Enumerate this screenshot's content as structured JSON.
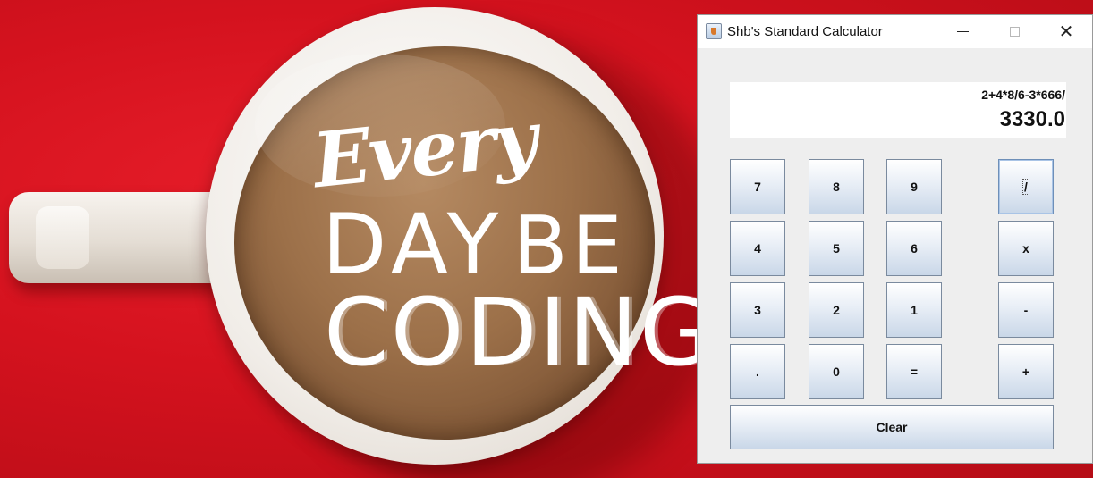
{
  "window": {
    "title": "Shb's Standard Calculator",
    "controls": {
      "minimize": "—",
      "maximize": "☐",
      "close": "✕"
    }
  },
  "display": {
    "expression": "2+4*8/6-3*666/",
    "result": "3330.0"
  },
  "keys": {
    "r1": [
      "7",
      "8",
      "9",
      "/"
    ],
    "r2": [
      "4",
      "5",
      "6",
      "x"
    ],
    "r3": [
      "3",
      "2",
      "1",
      "-"
    ],
    "r4": [
      ".",
      "0",
      "=",
      "+"
    ],
    "clear": "Clear"
  },
  "wallpaper": {
    "line1": "Every",
    "line2a": "DAY",
    "line2b": "BE",
    "line3": "CODING"
  },
  "colors": {
    "wallpaper_red": "#d4121e",
    "window_bg": "#eeeeee",
    "key_gradient_bottom": "#c9d7e8"
  }
}
